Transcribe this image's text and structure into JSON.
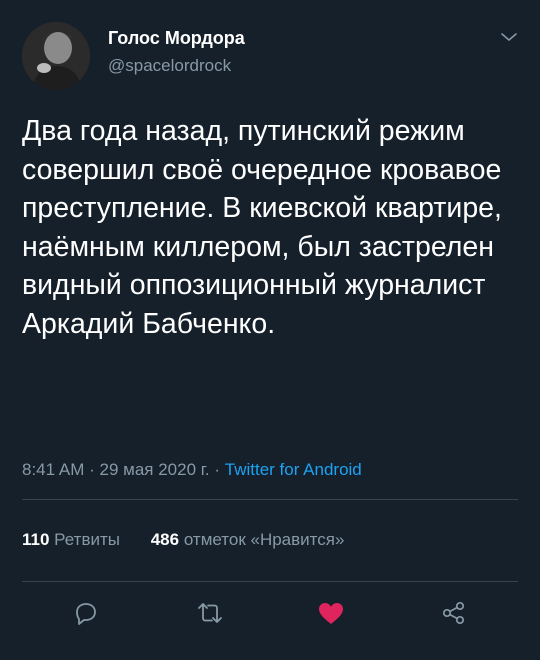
{
  "tweet": {
    "author_name": "Голос Мордора",
    "author_handle": "@spacelordrock",
    "text": "Два года назад, путинский режим совершил своё очередное кровавое преступление. В киевской квартире, наёмным киллером, был застрелен видный оппозиционный журналист Аркадий Бабченко.",
    "time": "8:41 AM",
    "separator1": "·",
    "date": "29 мая 2020 г.",
    "separator2": "·",
    "source": "Twitter for Android"
  },
  "stats": {
    "retweets_count": "110",
    "retweets_label": "Ретвиты",
    "likes_count": "486",
    "likes_label": "отметок «Нравится»"
  },
  "icons": {
    "menu": "chevron-down-icon",
    "reply": "reply-icon",
    "retweet": "retweet-icon",
    "like": "heart-icon",
    "share": "share-icon"
  },
  "colors": {
    "background": "#15202b",
    "text": "#ffffff",
    "secondary_text": "#8899a6",
    "link": "#1da1f2",
    "like_active": "#e0245e",
    "divider": "#38444d"
  }
}
